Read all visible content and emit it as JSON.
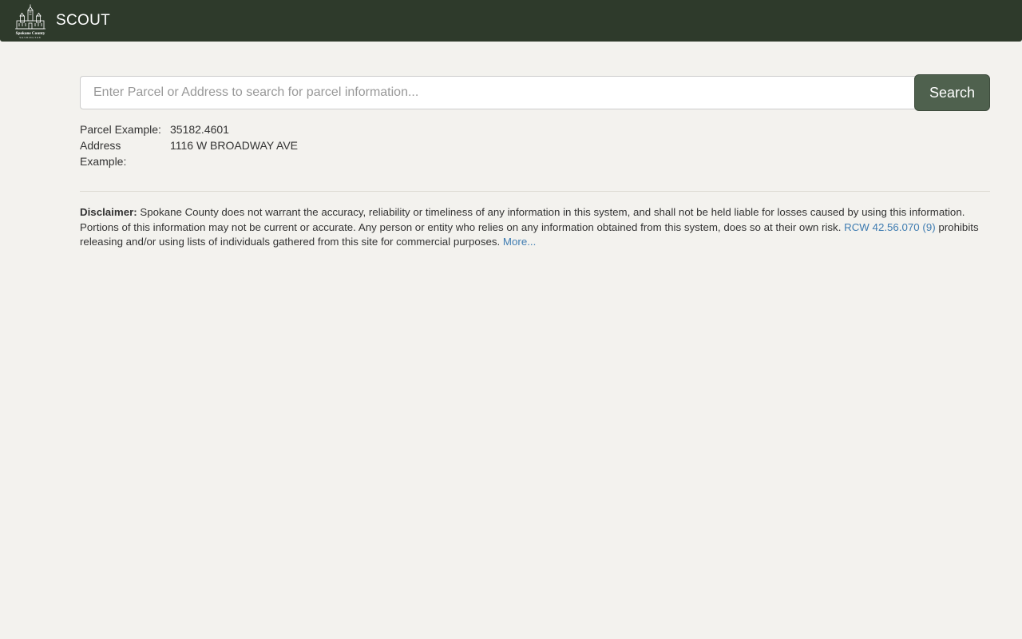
{
  "header": {
    "app_name": "SCOUT",
    "logo": {
      "line1": "Spokane County",
      "line2": "WASHINGTON"
    }
  },
  "search": {
    "placeholder": "Enter Parcel or Address to search for parcel information...",
    "value": "",
    "button_label": "Search"
  },
  "examples": [
    {
      "label": "Parcel Example:",
      "value": "35182.4601"
    },
    {
      "label": "Address Example:",
      "value": "1116 W BROADWAY AVE"
    }
  ],
  "disclaimer": {
    "label": "Disclaimer:",
    "text_part1": " Spokane County does not warrant the accuracy, reliability or timeliness of any information in this system, and shall not be held liable for losses caused by using this information. Portions of this information may not be current or accurate. Any person or entity who relies on any information obtained from this system, does so at their own risk. ",
    "link_rcw": "RCW 42.56.070 (9)",
    "text_part2": " prohibits releasing and/or using lists of individuals gathered from this site for commercial purposes. ",
    "link_more": "More..."
  },
  "colors": {
    "header_bg": "#2e3a2b",
    "page_bg": "#f3f2ee",
    "button_bg": "#4f614e",
    "button_border": "#3e4c3d",
    "link": "#3f7cb1",
    "text": "#333333",
    "placeholder": "#999999",
    "input_border": "#cccccc",
    "divider": "#dddad2"
  }
}
